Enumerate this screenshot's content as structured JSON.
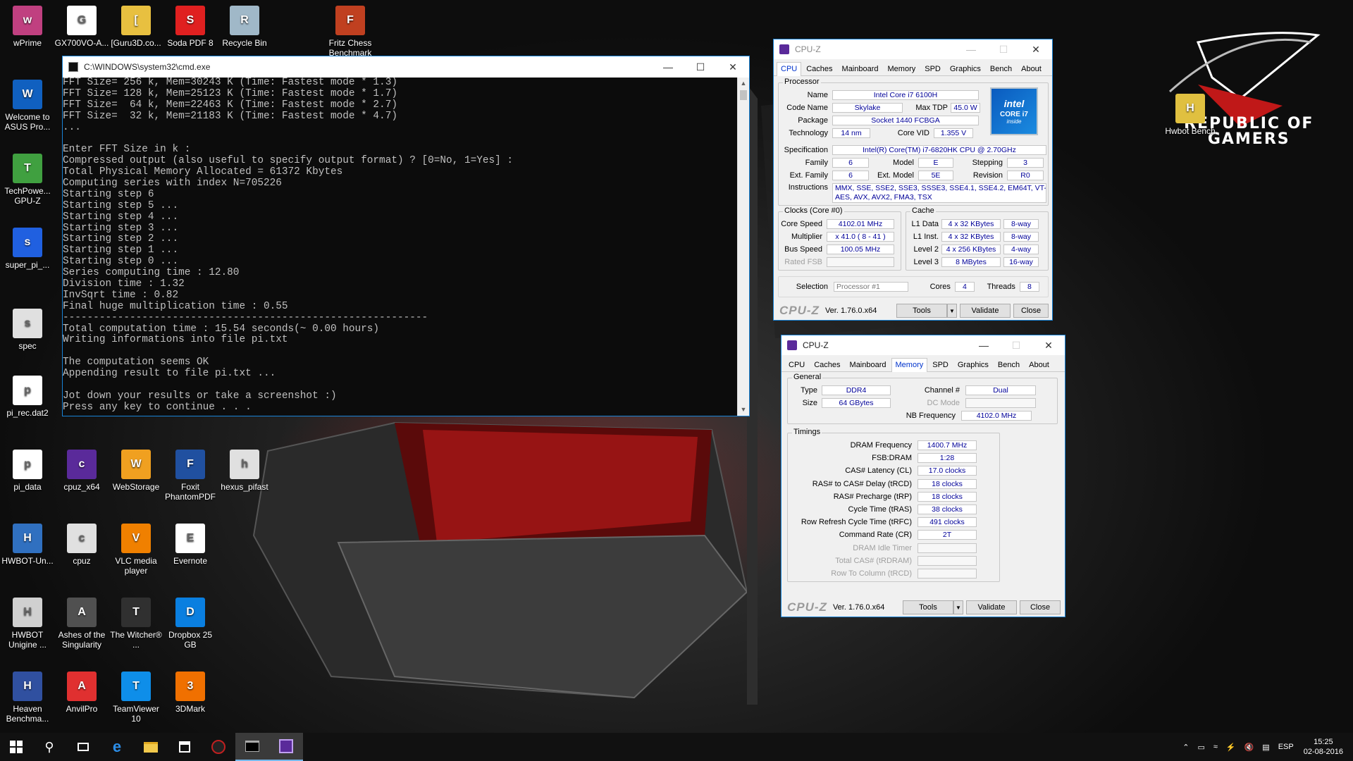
{
  "desktop": {
    "icons": [
      {
        "label": "wPrime",
        "icon": "wprime-icon",
        "color": "#c04080"
      },
      {
        "label": "GX700VO-A...",
        "icon": "document-icon",
        "color": "#ffffff"
      },
      {
        "label": "[Guru3D.co...",
        "icon": "zip-folder-icon",
        "color": "#e8c040"
      },
      {
        "label": "Soda PDF 8",
        "icon": "soda-pdf-icon",
        "color": "#e02020"
      },
      {
        "label": "Recycle Bin",
        "icon": "recycle-bin-icon",
        "color": "#a0b8c8"
      },
      {
        "label": "Fritz Chess Benchmark",
        "icon": "fritz-chess-icon",
        "color": "#c04020"
      },
      {
        "label": "Welcome to ASUS Pro...",
        "icon": "asus-icon",
        "color": "#1060c0"
      },
      {
        "label": "TechPowe... GPU-Z",
        "icon": "gpuz-icon",
        "color": "#40a040"
      },
      {
        "label": "super_pi_...",
        "icon": "superpi-icon",
        "color": "#2060e0"
      },
      {
        "label": "spec",
        "icon": "spec-icon",
        "color": "#e0e0e0"
      },
      {
        "label": "pi_rec.dat2",
        "icon": "document-icon",
        "color": "#ffffff"
      },
      {
        "label": "pi_data",
        "icon": "document-icon",
        "color": "#ffffff"
      },
      {
        "label": "cpuz_x64",
        "icon": "cpuz-icon",
        "color": "#5a2a9a"
      },
      {
        "label": "WebStorage",
        "icon": "webstorage-icon",
        "color": "#f0a020"
      },
      {
        "label": "Foxit PhantomPDF",
        "icon": "foxit-icon",
        "color": "#2050a0"
      },
      {
        "label": "hexus_pifast",
        "icon": "gear-document-icon",
        "color": "#e0e0e0"
      },
      {
        "label": "HWBOT-Un...",
        "icon": "hwbot-icon",
        "color": "#3070c0"
      },
      {
        "label": "cpuz",
        "icon": "gear-document-icon",
        "color": "#e0e0e0"
      },
      {
        "label": "VLC media player",
        "icon": "vlc-icon",
        "color": "#f08000"
      },
      {
        "label": "Evernote",
        "icon": "evernote-icon",
        "color": "#ffffff"
      },
      {
        "label": "HWBOT Unigine ...",
        "icon": "hwbot-unigine-icon",
        "color": "#d0d0d0"
      },
      {
        "label": "Ashes of the Singularity",
        "icon": "ashes-icon",
        "color": "#505050"
      },
      {
        "label": "The Witcher® ...",
        "icon": "witcher-icon",
        "color": "#303030"
      },
      {
        "label": "Dropbox 25 GB",
        "icon": "dropbox-icon",
        "color": "#0a7fe0"
      },
      {
        "label": "Heaven Benchma...",
        "icon": "heaven-icon",
        "color": "#3050a0"
      },
      {
        "label": "AnvilPro",
        "icon": "anvilpro-icon",
        "color": "#e03030"
      },
      {
        "label": "TeamViewer 10",
        "icon": "teamviewer-icon",
        "color": "#0e8ee9"
      },
      {
        "label": "3DMark",
        "icon": "3dmark-icon",
        "color": "#f07000"
      },
      {
        "label": "Hwbot Bench",
        "icon": "hwbot-bench-icon",
        "color": "#e0c040"
      }
    ],
    "wallpaper_brand": {
      "line1": "REPUBLIC OF",
      "line2": "GAMERS"
    }
  },
  "cmd": {
    "title": "C:\\WINDOWS\\system32\\cmd.exe",
    "lines": [
      "FFT Size= 256 k, Mem=30243 K (Time: Fastest mode * 1.3)",
      "FFT Size= 128 k, Mem=25123 K (Time: Fastest mode * 1.7)",
      "FFT Size=  64 k, Mem=22463 K (Time: Fastest mode * 2.7)",
      "FFT Size=  32 k, Mem=21183 K (Time: Fastest mode * 4.7)",
      "...",
      "",
      "Enter FFT Size in k :",
      "Compressed output (also useful to specify output format) ? [0=No, 1=Yes] :",
      "Total Physical Memory Allocated = 61372 Kbytes",
      "Computing series with index N=705226",
      "Starting step 6",
      "Starting step 5 ...",
      "Starting step 4 ...",
      "Starting step 3 ...",
      "Starting step 2 ...",
      "Starting step 1 ...",
      "Starting step 0 ...",
      "Series computing time : 12.80",
      "Division time : 1.32",
      "InvSqrt time : 0.82",
      "Final huge multiplication time : 0.55",
      "------------------------------------------------------------",
      "Total computation time : 15.54 seconds(~ 0.00 hours)",
      "Writing informations into file pi.txt",
      "",
      "The computation seems OK",
      "Appending result to file pi.txt ...",
      "",
      "Jot down your results or take a screenshot :)",
      "Press any key to continue . . ."
    ]
  },
  "cpuz_tabs": [
    "CPU",
    "Caches",
    "Mainboard",
    "Memory",
    "SPD",
    "Graphics",
    "Bench",
    "About"
  ],
  "cpuz1": {
    "title": "CPU-Z",
    "processor": {
      "group": "Processor",
      "name_l": "Name",
      "name": "Intel Core i7 6100H",
      "code_l": "Code Name",
      "code": "Skylake",
      "tdp_l": "Max TDP",
      "tdp": "45.0 W",
      "pkg_l": "Package",
      "pkg": "Socket 1440 FCBGA",
      "tech_l": "Technology",
      "tech": "14 nm",
      "vid_l": "Core VID",
      "vid": "1.355 V",
      "spec_l": "Specification",
      "spec": "Intel(R) Core(TM) i7-6820HK CPU @ 2.70GHz",
      "fam_l": "Family",
      "fam": "6",
      "model_l": "Model",
      "model": "E",
      "step_l": "Stepping",
      "step": "3",
      "efam_l": "Ext. Family",
      "efam": "6",
      "emodel_l": "Ext. Model",
      "emodel": "5E",
      "rev_l": "Revision",
      "rev": "R0",
      "instr_l": "Instructions",
      "instr1": "MMX, SSE, SSE2, SSE3, SSSE3, SSE4.1, SSE4.2, EM64T, VT-x,",
      "instr2": "AES, AVX, AVX2, FMA3, TSX",
      "badge": {
        "brand": "intel",
        "model": "CORE i7",
        "tag": "inside"
      }
    },
    "clocks": {
      "group": "Clocks (Core #0)",
      "cs_l": "Core Speed",
      "cs": "4102.01 MHz",
      "mult_l": "Multiplier",
      "mult": "x 41.0 ( 8 - 41 )",
      "bus_l": "Bus Speed",
      "bus": "100.05 MHz",
      "fsb_l": "Rated FSB",
      "fsb": ""
    },
    "cache": {
      "group": "Cache",
      "l1d_l": "L1 Data",
      "l1d": "4 x 32 KBytes",
      "l1d_w": "8-way",
      "l1i_l": "L1 Inst.",
      "l1i": "4 x 32 KBytes",
      "l1i_w": "8-way",
      "l2_l": "Level 2",
      "l2": "4 x 256 KBytes",
      "l2_w": "4-way",
      "l3_l": "Level 3",
      "l3": "8 MBytes",
      "l3_w": "16-way"
    },
    "sel": {
      "sel_l": "Selection",
      "sel": "Processor #1",
      "cores_l": "Cores",
      "cores": "4",
      "threads_l": "Threads",
      "threads": "8"
    },
    "footer": {
      "logo": "CPU-Z",
      "ver": "Ver. 1.76.0.x64",
      "tools": "Tools",
      "validate": "Validate",
      "close": "Close"
    }
  },
  "cpuz2": {
    "title": "CPU-Z",
    "general": {
      "group": "General",
      "type_l": "Type",
      "type": "DDR4",
      "size_l": "Size",
      "size": "64 GBytes",
      "chan_l": "Channel #",
      "chan": "Dual",
      "dc_l": "DC Mode",
      "dc": "",
      "nb_l": "NB Frequency",
      "nb": "4102.0 MHz"
    },
    "timings": {
      "group": "Timings",
      "rows": [
        {
          "label": "DRAM Frequency",
          "value": "1400.7 MHz",
          "dim": false
        },
        {
          "label": "FSB:DRAM",
          "value": "1:28",
          "dim": false
        },
        {
          "label": "CAS# Latency (CL)",
          "value": "17.0 clocks",
          "dim": false
        },
        {
          "label": "RAS# to CAS# Delay (tRCD)",
          "value": "18 clocks",
          "dim": false
        },
        {
          "label": "RAS# Precharge (tRP)",
          "value": "18 clocks",
          "dim": false
        },
        {
          "label": "Cycle Time (tRAS)",
          "value": "38 clocks",
          "dim": false
        },
        {
          "label": "Row Refresh Cycle Time (tRFC)",
          "value": "491 clocks",
          "dim": false
        },
        {
          "label": "Command Rate (CR)",
          "value": "2T",
          "dim": false
        },
        {
          "label": "DRAM Idle Timer",
          "value": "",
          "dim": true
        },
        {
          "label": "Total CAS# (tRDRAM)",
          "value": "",
          "dim": true
        },
        {
          "label": "Row To Column (tRCD)",
          "value": "",
          "dim": true
        }
      ]
    },
    "footer": {
      "logo": "CPU-Z",
      "ver": "Ver. 1.76.0.x64",
      "tools": "Tools",
      "validate": "Validate",
      "close": "Close"
    }
  },
  "taskbar": {
    "tray_lang": "ESP",
    "time": "15:25",
    "date": "02-08-2016"
  }
}
